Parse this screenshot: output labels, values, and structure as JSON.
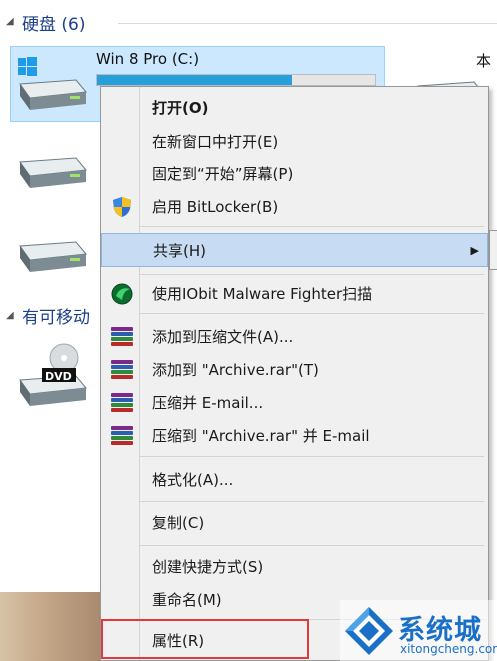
{
  "explorer": {
    "section_disks": "硬盘 (6)",
    "section_removable": "有可移动",
    "drive_selected": "Win 8 Pro (C:)",
    "drive_right_partial": "本",
    "drive_selected_fill": 0.7,
    "dvd_label": "DVD"
  },
  "context_menu": {
    "items": [
      {
        "label": "打开(O)",
        "bold": true
      },
      {
        "label": "在新窗口中打开(E)"
      },
      {
        "label": "固定到“开始”屏幕(P)"
      },
      {
        "label": "启用 BitLocker(B)",
        "icon": "shield-icon"
      },
      {
        "label": "共享(H)",
        "submenu": true
      },
      {
        "label": "使用IObit Malware Fighter扫描",
        "icon": "iobit-icon"
      },
      {
        "label": "添加到压缩文件(A)...",
        "icon": "winrar-icon"
      },
      {
        "label": "添加到 \"Archive.rar\"(T)",
        "icon": "winrar-icon"
      },
      {
        "label": "压缩并 E-mail...",
        "icon": "winrar-icon"
      },
      {
        "label": "压缩到 \"Archive.rar\" 并 E-mail",
        "icon": "winrar-icon"
      },
      {
        "label": "格式化(A)..."
      },
      {
        "label": "复制(C)"
      },
      {
        "label": "创建快捷方式(S)"
      },
      {
        "label": "重命名(M)"
      },
      {
        "label": "属性(R)"
      }
    ]
  },
  "watermark": {
    "brand": "系统城",
    "url": "xitongcheng.com"
  },
  "colors": {
    "accent": "#26a0da",
    "highlight": "#c7dcf3",
    "red_box": "#e03a3a",
    "watermark_blue": "#1a6fc7"
  }
}
